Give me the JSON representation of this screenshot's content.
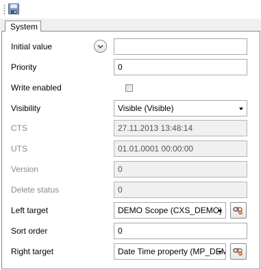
{
  "toolbar": {
    "save_icon": "save-icon"
  },
  "tabs": [
    {
      "label": "System"
    }
  ],
  "fields": {
    "initial_value": {
      "label": "Initial value",
      "value": ""
    },
    "priority": {
      "label": "Priority",
      "value": "0"
    },
    "write_enabled": {
      "label": "Write enabled",
      "checked": false
    },
    "visibility": {
      "label": "Visibility",
      "value": "Visible (Visible)"
    },
    "cts": {
      "label": "CTS",
      "value": "27.11.2013 13:48:14"
    },
    "uts": {
      "label": "UTS",
      "value": "01.01.0001 00:00:00"
    },
    "version": {
      "label": "Version",
      "value": "0"
    },
    "delete_status": {
      "label": "Delete status",
      "value": "0"
    },
    "left_target": {
      "label": "Left target",
      "value": "DEMO Scope (CXS_DEMO)"
    },
    "sort_order": {
      "label": "Sort order",
      "value": "0"
    },
    "right_target": {
      "label": "Right target",
      "value": "Date Time property (MP_DEMO"
    }
  }
}
